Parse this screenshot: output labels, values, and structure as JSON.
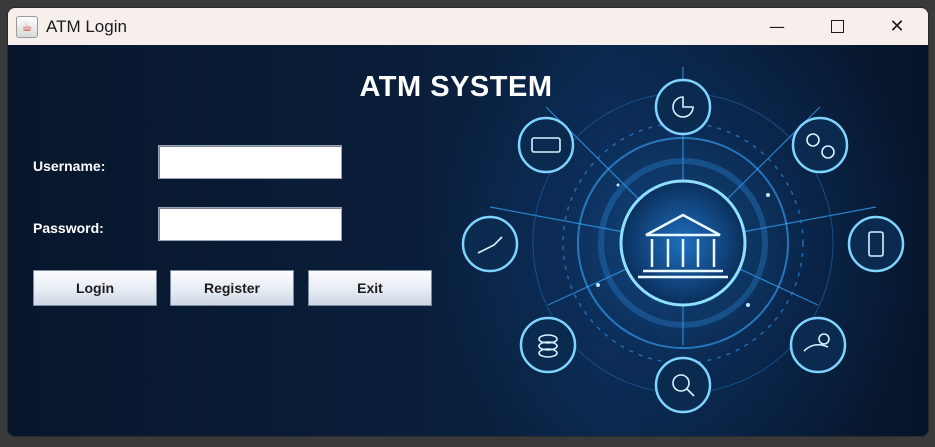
{
  "window": {
    "title": "ATM Login",
    "app_icon": "java-cup-icon",
    "controls": {
      "minimize": "—",
      "close": "✕"
    }
  },
  "main": {
    "heading": "ATM SYSTEM",
    "username_label": "Username:",
    "password_label": "Password:",
    "username_value": "",
    "password_value": "",
    "buttons": {
      "login": "Login",
      "register": "Register",
      "exit": "Exit"
    }
  },
  "background_graphic": {
    "description_icons": [
      "bank-icon",
      "pie-chart-icon",
      "currency-exchange-icon",
      "phone-payment-icon",
      "hand-coin-icon",
      "dollar-search-icon",
      "coin-stack-icon",
      "growth-chart-icon",
      "banknote-icon"
    ],
    "glow_color": "#4fc3ff"
  }
}
